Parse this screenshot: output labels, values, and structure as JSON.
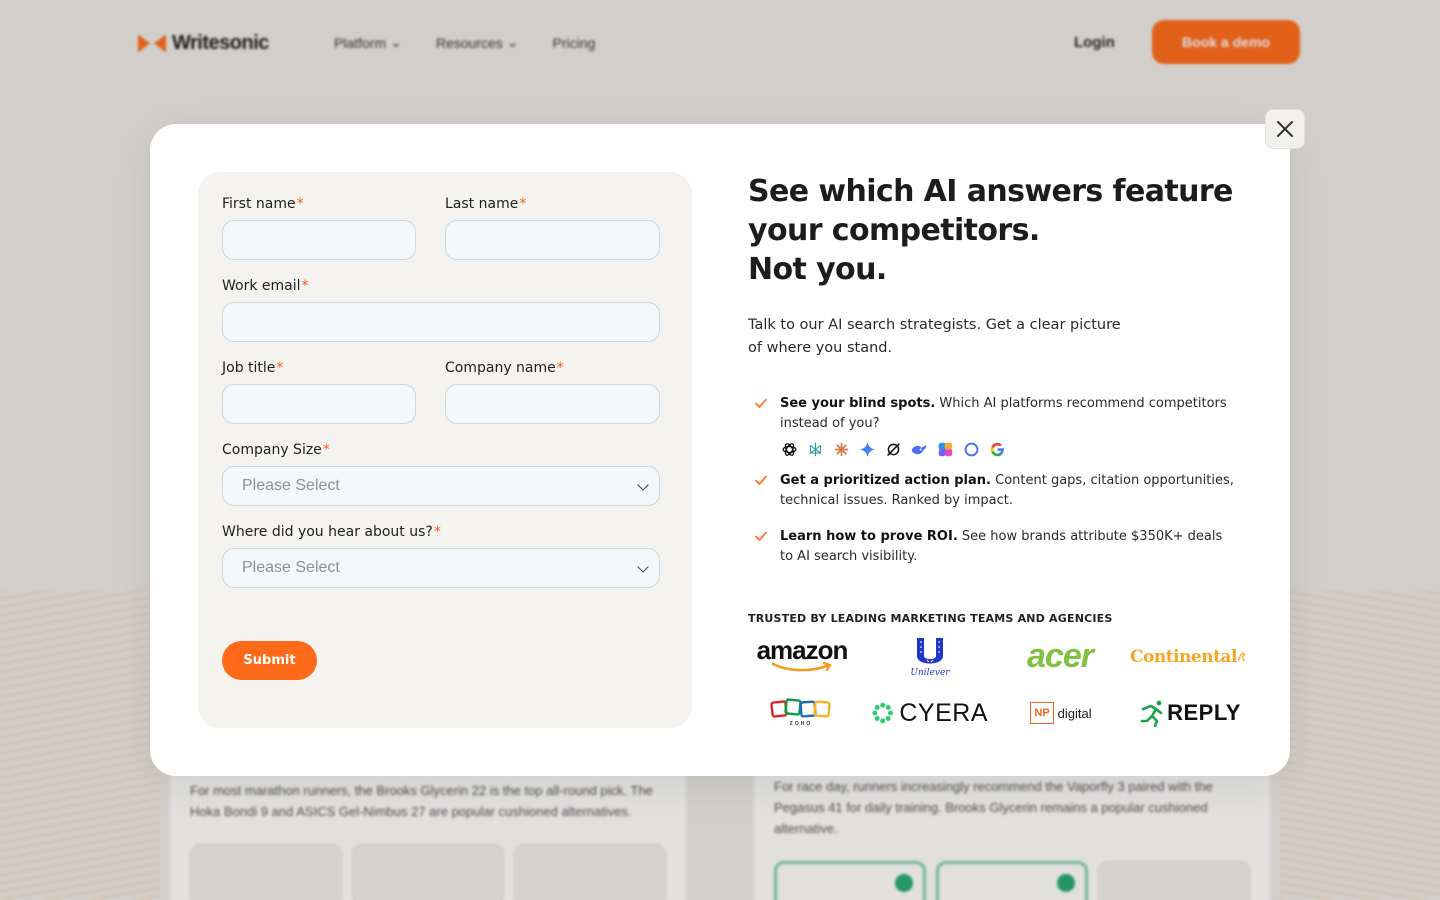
{
  "nav": {
    "brand": "Writesonic",
    "links": [
      "Platform",
      "Resources",
      "Pricing"
    ],
    "login": "Login",
    "cta": "Book a demo"
  },
  "background": {
    "left_text": "For most marathon runners, the Brooks Glycerin 22 is the top all-round pick. The Hoka Bondi 9 and ASICS Gel-Nimbus 27 are popular cushioned alternatives.",
    "right_text": "For race day, runners increasingly recommend the Vaporfly 3 paired with the Pegasus 41 for daily training. Brooks Glycerin remains a popular cushioned alternative."
  },
  "form": {
    "first_name_label": "First name",
    "last_name_label": "Last name",
    "work_email_label": "Work email",
    "job_title_label": "Job title",
    "company_name_label": "Company name",
    "company_size_label": "Company Size",
    "heard_label": "Where did you hear about us?",
    "required_mark": "*",
    "select_placeholder": "Please Select",
    "submit_label": "Submit"
  },
  "info": {
    "headline_line1": "See which AI answers feature your competitors.",
    "headline_line2": "Not you.",
    "subtext": "Talk to our AI search strategists. Get a clear picture of where you stand.",
    "bullets": [
      {
        "bold": "See your blind spots.",
        "text": " Which AI platforms recommend competitors instead of you?"
      },
      {
        "bold": "Get a prioritized action plan.",
        "text": " Content gaps, citation opportunities, technical issues. Ranked by impact."
      },
      {
        "bold": "Learn how to prove ROI.",
        "text": " See how brands attribute $350K+ deals to AI search visibility."
      }
    ],
    "ai_icons": [
      "chatgpt-icon",
      "perplexity-icon",
      "claude-icon",
      "gemini-icon",
      "grok-icon",
      "deepseek-icon",
      "copilot-icon",
      "meta-ai-icon",
      "google-icon"
    ],
    "trusted_label": "TRUSTED BY LEADING MARKETING TEAMS AND AGENCIES",
    "brands": {
      "amazon": "amazon",
      "unilever": "Unilever",
      "acer": "acer",
      "continental": "Continental",
      "zoho": "ZOHO",
      "cyera": "CYERA",
      "np_badge": "NP",
      "np_digital": "digital",
      "reply": "REPLY"
    }
  },
  "colors": {
    "accent": "#ff6a1a",
    "form_bg": "#f4f3ef",
    "input_bg": "#f5f8fa",
    "input_border": "#cbd6e2"
  }
}
